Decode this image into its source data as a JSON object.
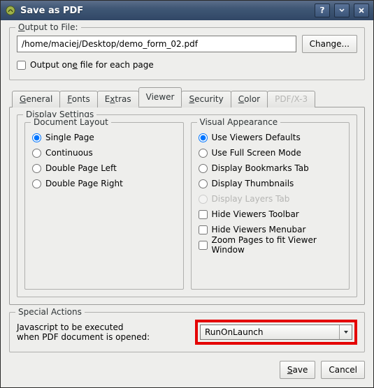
{
  "window": {
    "title": "Save as PDF"
  },
  "output": {
    "legend": "Output to File:",
    "accesskey": "O",
    "path": "/home/maciej/Desktop/demo_form_02.pdf",
    "change_label": "Change...",
    "one_file_each_label": "Output one file for each page",
    "one_file_each_accesskey": "e",
    "one_file_each_checked": false
  },
  "tabs": {
    "items": [
      {
        "label": "General",
        "accesskey": "G",
        "active": false,
        "disabled": false
      },
      {
        "label": "Fonts",
        "accesskey": "F",
        "active": false,
        "disabled": false
      },
      {
        "label": "Extras",
        "accesskey": "x",
        "active": false,
        "disabled": false
      },
      {
        "label": "Viewer",
        "accesskey": "",
        "active": true,
        "disabled": false
      },
      {
        "label": "Security",
        "accesskey": "S",
        "active": false,
        "disabled": false
      },
      {
        "label": "Color",
        "accesskey": "C",
        "active": false,
        "disabled": false
      },
      {
        "label": "PDF/X-3",
        "accesskey": "",
        "active": false,
        "disabled": true
      }
    ]
  },
  "viewer": {
    "display_settings_legend": "Display Settings",
    "doc_layout": {
      "legend": "Document Layout",
      "options": [
        {
          "label": "Single Page",
          "selected": true,
          "disabled": false
        },
        {
          "label": "Continuous",
          "selected": false,
          "disabled": false
        },
        {
          "label": "Double Page Left",
          "selected": false,
          "disabled": false
        },
        {
          "label": "Double Page Right",
          "selected": false,
          "disabled": false
        }
      ]
    },
    "visual": {
      "legend": "Visual Appearance",
      "radios": [
        {
          "label": "Use Viewers Defaults",
          "selected": true,
          "disabled": false
        },
        {
          "label": "Use Full Screen Mode",
          "selected": false,
          "disabled": false
        },
        {
          "label": "Display Bookmarks Tab",
          "selected": false,
          "disabled": false
        },
        {
          "label": "Display Thumbnails",
          "selected": false,
          "disabled": false
        },
        {
          "label": "Display Layers Tab",
          "selected": false,
          "disabled": true
        }
      ],
      "checks": [
        {
          "label": "Hide Viewers Toolbar",
          "checked": false
        },
        {
          "label": "Hide Viewers Menubar",
          "checked": false
        },
        {
          "label": "Zoom Pages to fit Viewer Window",
          "checked": false
        }
      ]
    }
  },
  "special": {
    "legend": "Special Actions",
    "js_label_line1": "Javascript to be executed",
    "js_label_line2": "when PDF document is opened:",
    "selected": "RunOnLaunch"
  },
  "dialog": {
    "save_label": "Save",
    "save_accesskey": "S",
    "cancel_label": "Cancel"
  },
  "colors": {
    "highlight_border": "#e40000"
  }
}
